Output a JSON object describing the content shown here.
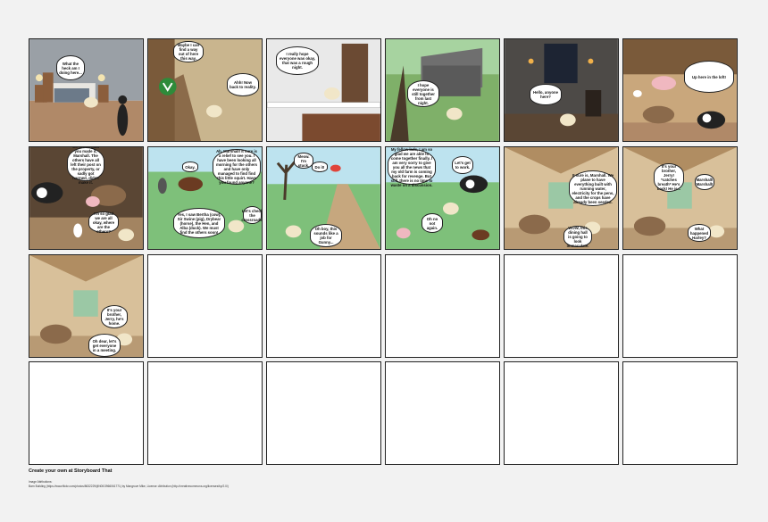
{
  "panels": [
    {
      "id": 1,
      "bubbles": [
        "What the heck am I doing here..."
      ]
    },
    {
      "id": 2,
      "bubbles": [
        "Maybe I can find a way out of here this way.",
        "Ahh! Now back to reality."
      ]
    },
    {
      "id": 3,
      "bubbles": [
        "I really hope everyone was okay, that was a rough night."
      ]
    },
    {
      "id": 4,
      "bubbles": [
        "I hope everyone is still together from last night."
      ]
    },
    {
      "id": 5,
      "bubbles": [
        "Hello, anyone here?"
      ]
    },
    {
      "id": 6,
      "bubbles": [
        "Up here in the loft!"
      ]
    },
    {
      "id": 7,
      "bubbles": [
        "We are all glad you made it, Marshall. The others have all left their post on the property, or sadly got harmed, didn't make it.",
        "I'm so glad we are all okay, where are the others?"
      ]
    },
    {
      "id": 8,
      "bubbles": [
        "Okay.",
        "Ah, Marshall! It sure is a relief to see you. I have been looking all morning for the others and have only managed to find find this little squirt. Have you found anyone?",
        "Yes, I saw Bertha (cow), Sir Swine (pig), Drybear (horse), the Hen, and Alba (duck). We must find the others soon!",
        "Let's check the crossroads."
      ]
    },
    {
      "id": 9,
      "bubbles": [
        "Meow. I'm stuck.",
        "Do it!",
        "Oh boy, this sounds like a job for Gunny..."
      ]
    },
    {
      "id": 10,
      "bubbles": [
        "My fellow lads, I am so glad we are able to come together finally. I am very sorry to give you all the news that my old farm is coming back for revenge. But still, there is no time to waste on a discussion.",
        "Let's get to work.",
        "Oh no not again."
      ]
    },
    {
      "id": 11,
      "bubbles": [
        "It sure is, Marshall. We plane to have everything built with running water, electricity for the pens, and the crops have already been seeded.",
        "WOW, this dining hall is going to look immaculate."
      ]
    },
    {
      "id": 12,
      "bubbles": [
        "It's your brother, Jerry! *catches breath* He's back! He is...",
        "Marshall! Marshall!",
        "What happened Harley?"
      ]
    },
    {
      "id": 13,
      "bubbles": [
        "It's your brother, Jerry, he's home.",
        "Oh dear, let's get everyone in a meeting."
      ]
    }
  ],
  "footer": {
    "title": "Create your own at Storyboard That",
    "attributions_label": "Image Attributions:",
    "attributions_text": "Barn Building (https://www.flickr.com/photos/8632229@N00/3966061771) by Mangrove Mike, License: Attribution (http://creativecommons.org/licenses/by/2.0/)"
  }
}
